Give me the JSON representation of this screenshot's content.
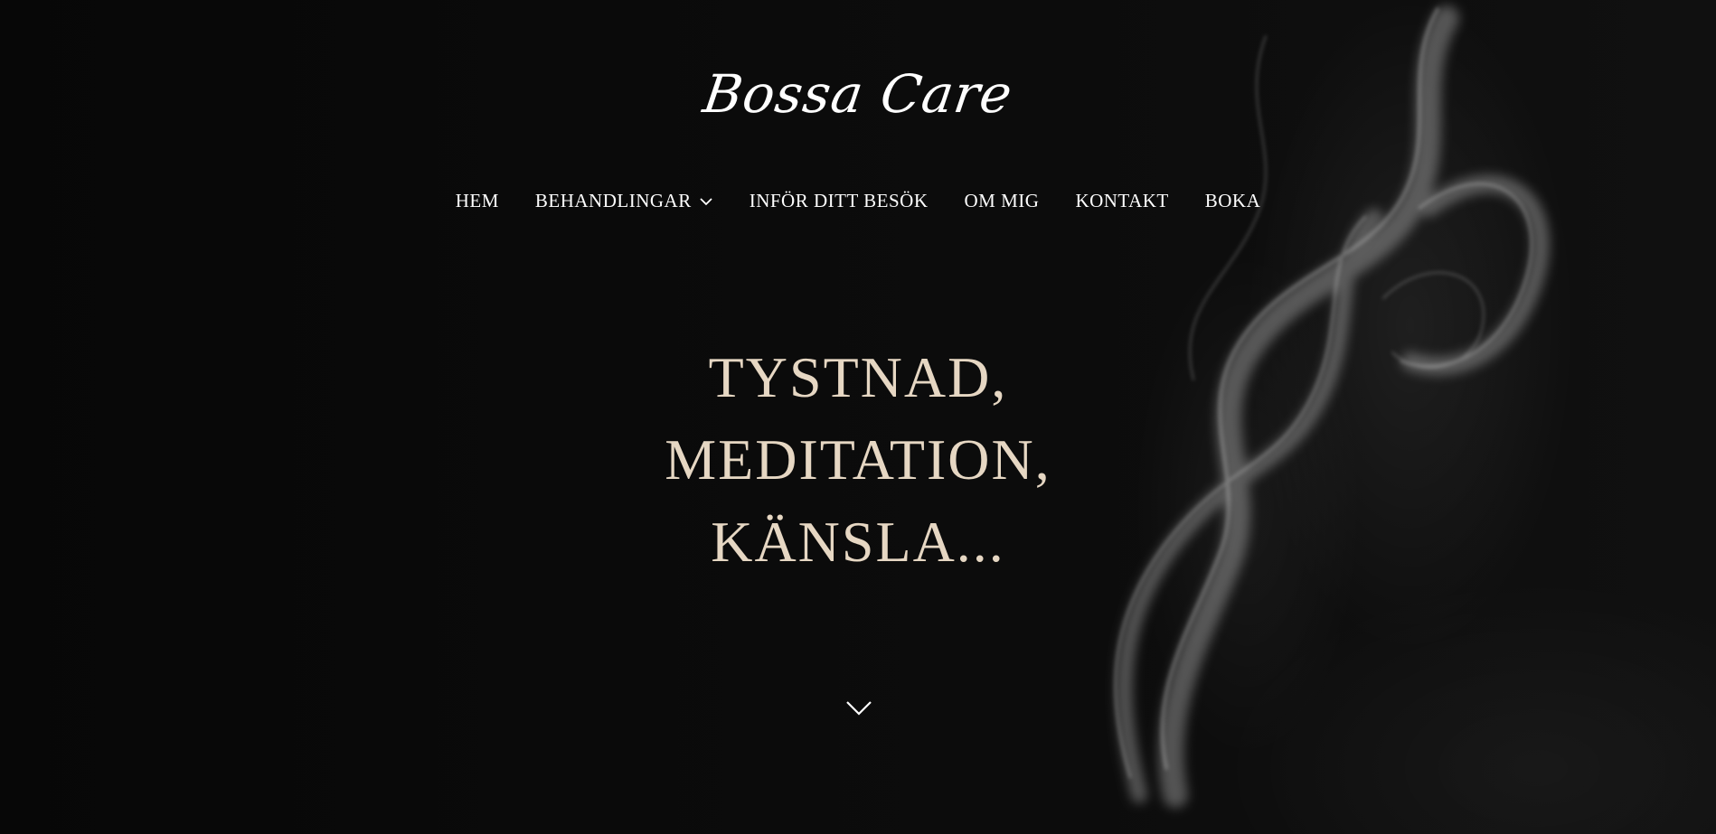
{
  "brand": {
    "logo_text": "Bossa Care"
  },
  "nav": {
    "items": [
      {
        "label": "HEM",
        "has_dropdown": false
      },
      {
        "label": "BEHANDLINGAR",
        "has_dropdown": true
      },
      {
        "label": "INFÖR DITT BESÖK",
        "has_dropdown": false
      },
      {
        "label": "OM MIG",
        "has_dropdown": false
      },
      {
        "label": "KONTAKT",
        "has_dropdown": false
      },
      {
        "label": "BOKA",
        "has_dropdown": false
      }
    ]
  },
  "hero": {
    "lines": [
      "TYSTNAD,",
      "MEDITATION,",
      "KÄNSLA..."
    ],
    "scroll_icon": "chevron-down-icon"
  },
  "colors": {
    "background": "#0a0a0a",
    "nav_text": "#ffffff",
    "headline": "#e6d7c3"
  }
}
